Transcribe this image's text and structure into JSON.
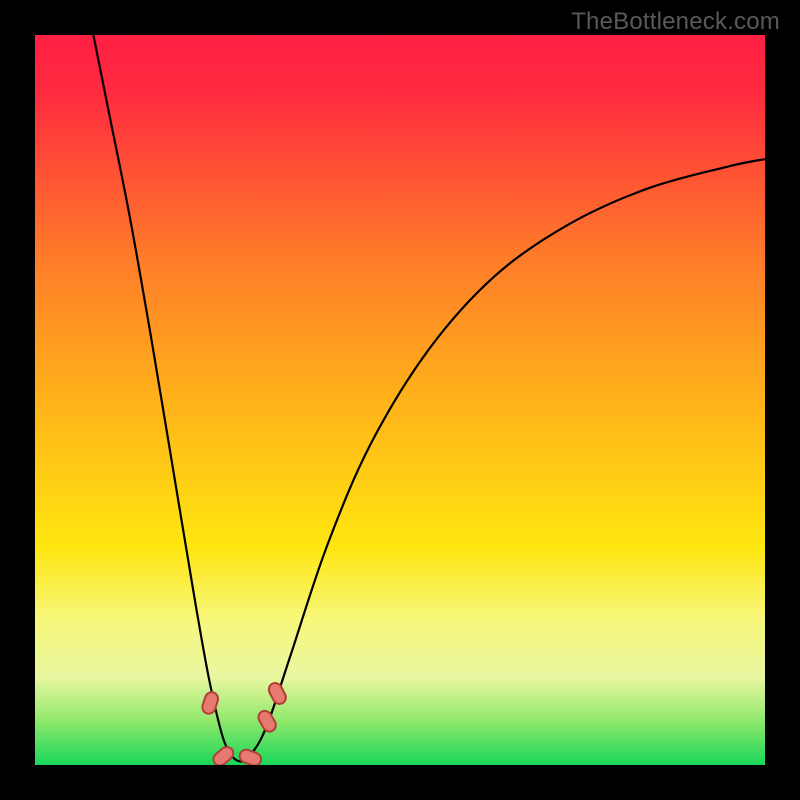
{
  "watermark": "TheBottleneck.com",
  "chart_data": {
    "type": "line",
    "title": "",
    "xlabel": "",
    "ylabel": "",
    "xlim": [
      0,
      100
    ],
    "ylim": [
      0,
      100
    ],
    "background_gradient": {
      "stops": [
        {
          "offset": 0.0,
          "color": "#ff1f44"
        },
        {
          "offset": 0.08,
          "color": "#ff2b3f"
        },
        {
          "offset": 0.3,
          "color": "#ff7a2a"
        },
        {
          "offset": 0.5,
          "color": "#ffb21a"
        },
        {
          "offset": 0.7,
          "color": "#ffe610"
        },
        {
          "offset": 0.8,
          "color": "#f7f77a"
        },
        {
          "offset": 0.88,
          "color": "#e9f7a1"
        },
        {
          "offset": 0.94,
          "color": "#8fe86a"
        },
        {
          "offset": 1.0,
          "color": "#17d65a"
        }
      ]
    },
    "series": [
      {
        "name": "bottleneck-curve",
        "optimal_x": 28,
        "comment": "V-shaped curve dipping to near 0 around x≈28 and rising steeply on both sides; y read as distance from bottom (0) to top (100)",
        "points": [
          {
            "x": 8,
            "y": 100
          },
          {
            "x": 10,
            "y": 90
          },
          {
            "x": 13,
            "y": 75
          },
          {
            "x": 16,
            "y": 58
          },
          {
            "x": 19,
            "y": 40
          },
          {
            "x": 22,
            "y": 22
          },
          {
            "x": 24,
            "y": 11
          },
          {
            "x": 26,
            "y": 3
          },
          {
            "x": 28,
            "y": 0.5
          },
          {
            "x": 30,
            "y": 2
          },
          {
            "x": 32,
            "y": 6
          },
          {
            "x": 35,
            "y": 15
          },
          {
            "x": 40,
            "y": 30
          },
          {
            "x": 46,
            "y": 44
          },
          {
            "x": 54,
            "y": 57
          },
          {
            "x": 63,
            "y": 67
          },
          {
            "x": 73,
            "y": 74
          },
          {
            "x": 84,
            "y": 79
          },
          {
            "x": 95,
            "y": 82
          },
          {
            "x": 100,
            "y": 83
          }
        ]
      }
    ],
    "markers": [
      {
        "x": 24.0,
        "y": 8.5,
        "angle": -72
      },
      {
        "x": 25.8,
        "y": 1.2,
        "angle": -40
      },
      {
        "x": 29.5,
        "y": 1.0,
        "angle": 20
      },
      {
        "x": 31.8,
        "y": 6.0,
        "angle": 60
      },
      {
        "x": 33.2,
        "y": 9.8,
        "angle": 62
      }
    ],
    "marker_style": {
      "fill": "#e77a70",
      "stroke": "#b13f35",
      "rx": 7,
      "length": 22,
      "width": 13
    }
  }
}
